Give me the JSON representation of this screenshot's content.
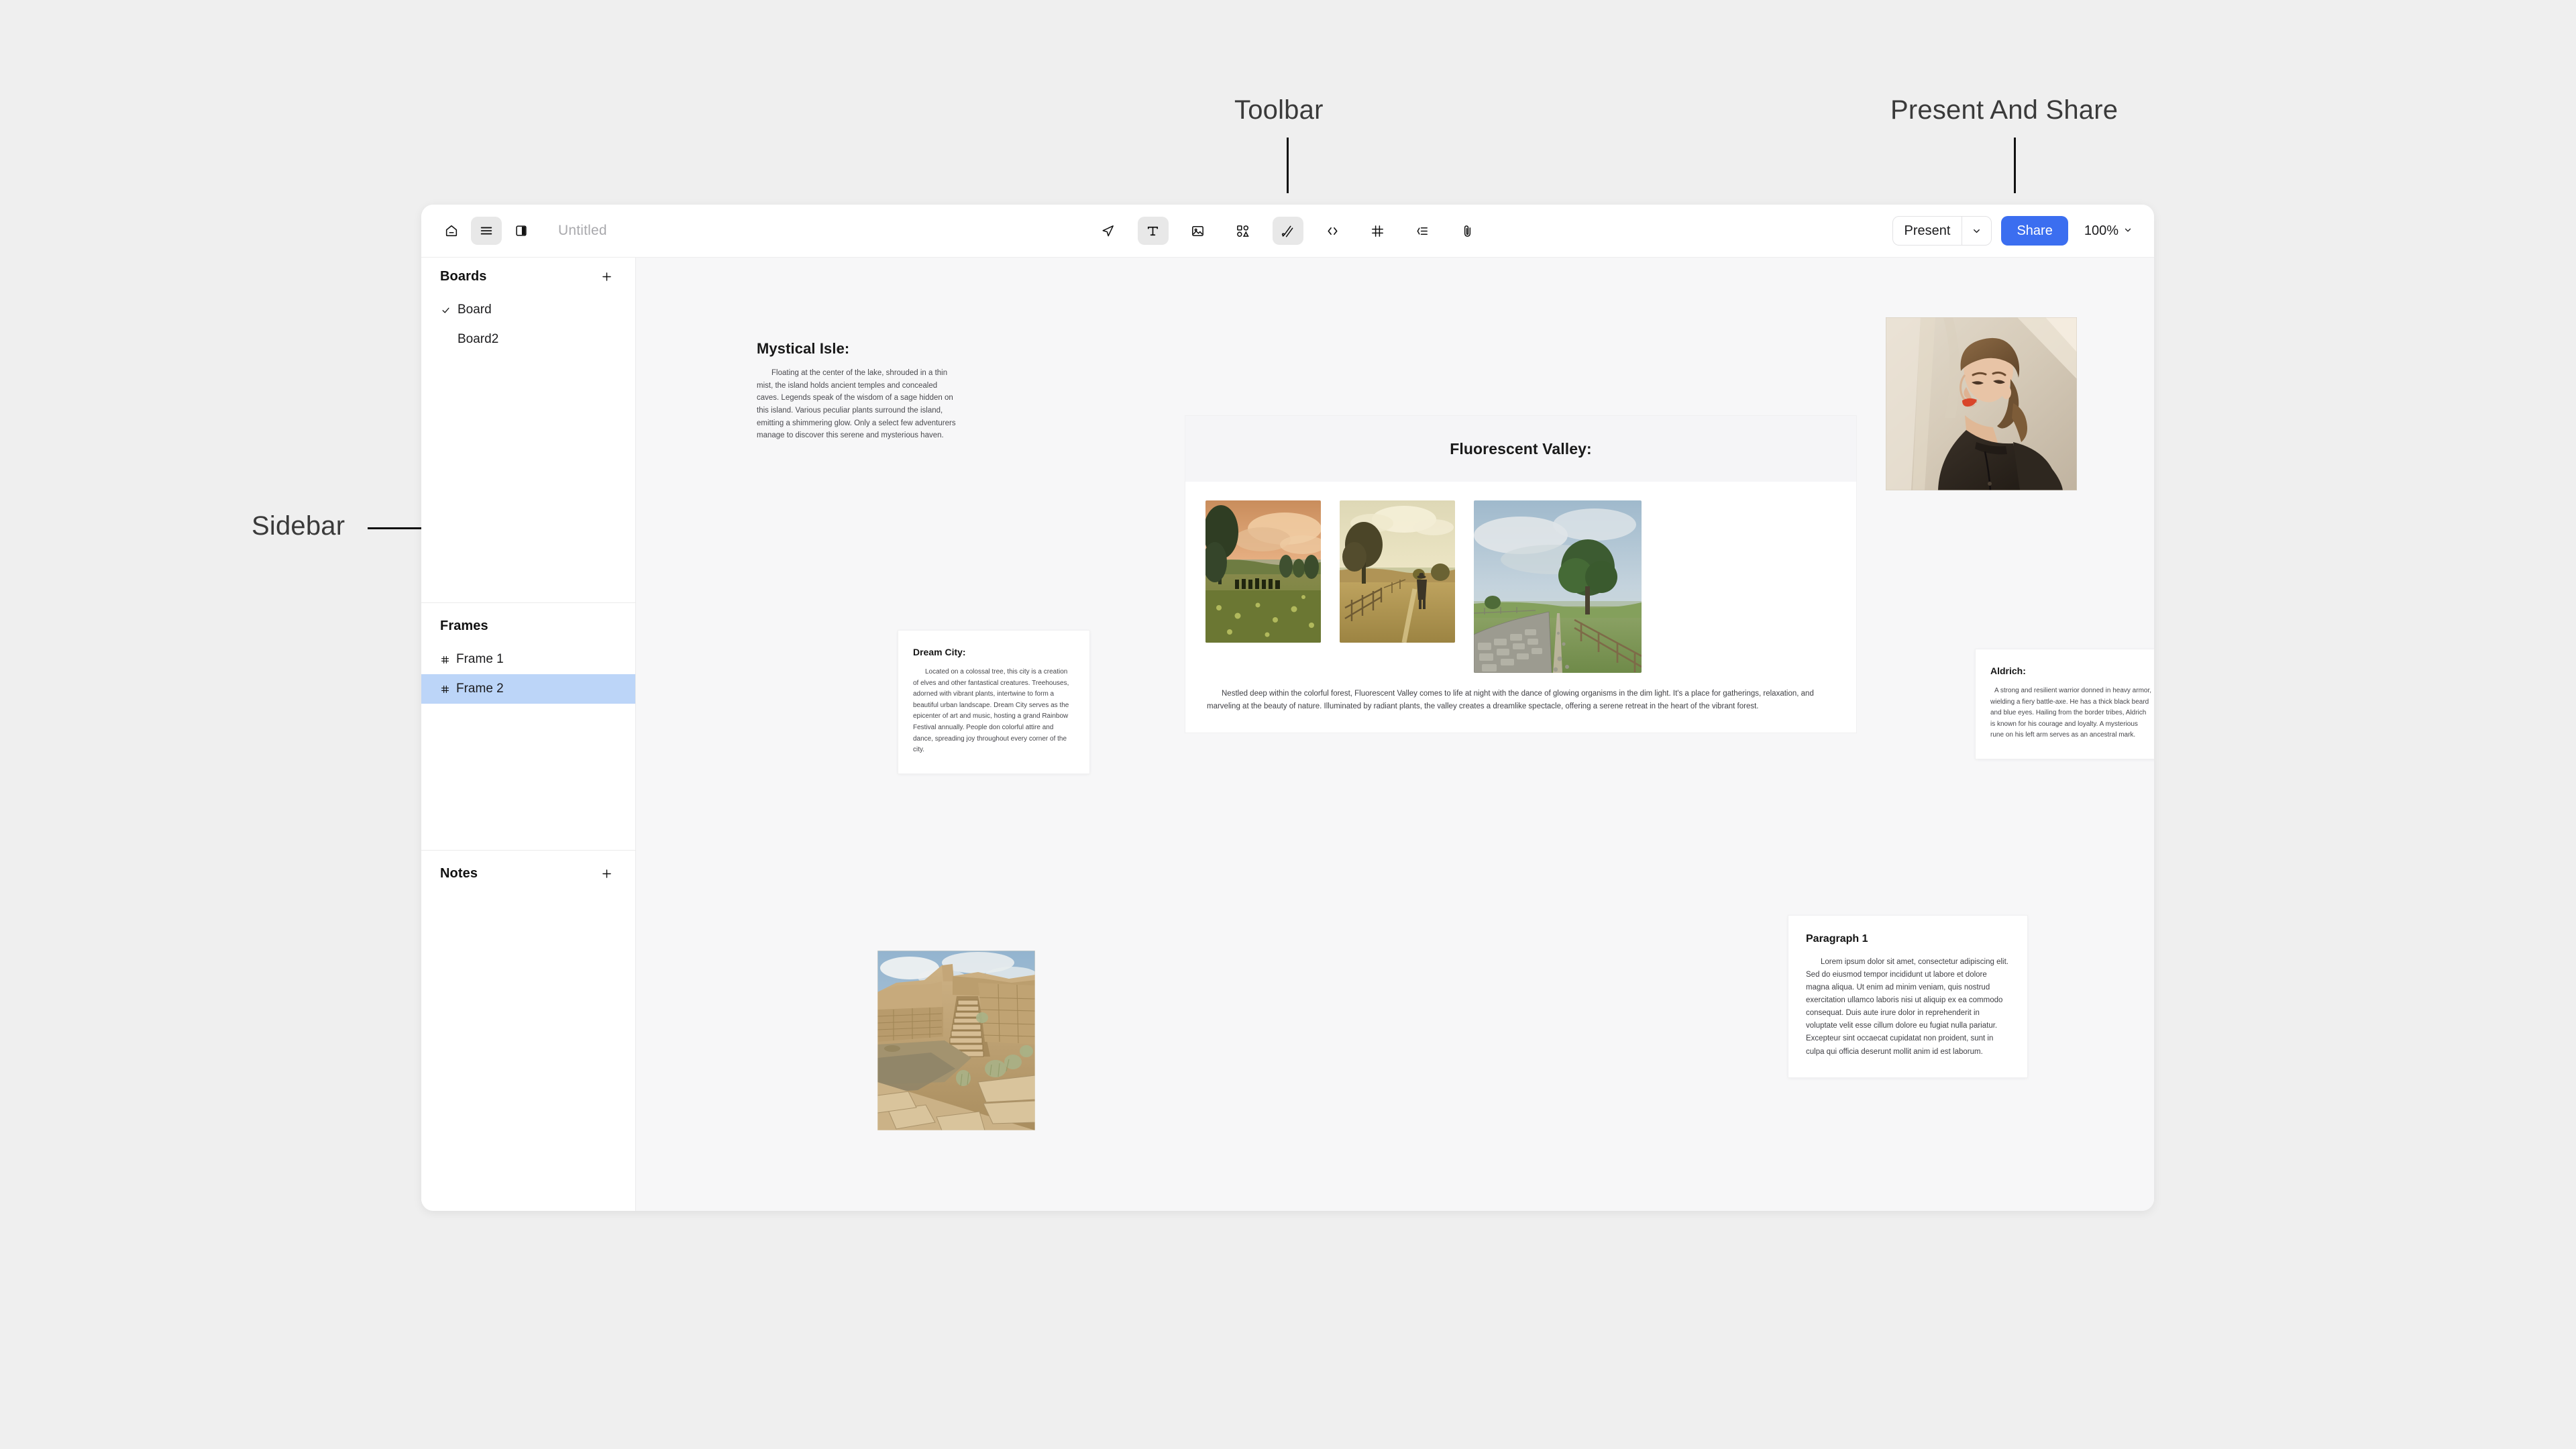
{
  "annotations": [
    {
      "id": "toolbar",
      "label": "Toolbar"
    },
    {
      "id": "present",
      "label": "Present And Share"
    },
    {
      "id": "sidebar",
      "label": "Sidebar"
    }
  ],
  "colors": {
    "accent": "#3b6ef0",
    "selection": "#bcd5f8",
    "canvas_bg": "#f7f7f8",
    "page_bg": "#efefef",
    "toolbar_active_bg": "#e8e8e8"
  },
  "topbar": {
    "left_icons": [
      {
        "name": "home-icon",
        "label": "Home"
      },
      {
        "name": "menu-icon",
        "label": "Menu",
        "active": true
      },
      {
        "name": "panel-toggle-icon",
        "label": "Toggle panel"
      }
    ],
    "document_title_placeholder": "Untitled",
    "document_title_value": "",
    "tools": [
      {
        "name": "cursor-icon",
        "label": "Select",
        "active": false
      },
      {
        "name": "text-icon",
        "label": "Text",
        "active": true
      },
      {
        "name": "image-icon",
        "label": "Image",
        "active": false
      },
      {
        "name": "shapes-icon",
        "label": "Shapes",
        "active": false
      },
      {
        "name": "pen-icon",
        "label": "Draw",
        "active": true
      },
      {
        "name": "code-icon",
        "label": "Embed",
        "active": false
      },
      {
        "name": "frame-icon",
        "label": "Frame",
        "active": false
      },
      {
        "name": "list-icon",
        "label": "List",
        "active": false
      },
      {
        "name": "attachment-icon",
        "label": "Attach",
        "active": false
      }
    ],
    "present_label": "Present",
    "share_label": "Share",
    "zoom_level": "100%"
  },
  "sidebar": {
    "boards": {
      "title": "Boards",
      "add_label": "+",
      "items": [
        {
          "label": "Board",
          "checked": true
        },
        {
          "label": "Board2",
          "checked": false
        }
      ]
    },
    "frames": {
      "title": "Frames",
      "items": [
        {
          "label": "Frame 1",
          "selected": false
        },
        {
          "label": "Frame 2",
          "selected": true
        }
      ]
    },
    "notes": {
      "title": "Notes",
      "add_label": "+",
      "items": []
    }
  },
  "canvas": {
    "mystical_isle": {
      "title": "Mystical Isle:",
      "body": "Floating at the center of the lake, shrouded in a thin mist, the island holds ancient temples and concealed caves. Legends speak of the wisdom of a sage hidden on this island. Various peculiar plants surround the island, emitting a shimmering glow. Only a select few adventurers manage to discover this serene and mysterious haven."
    },
    "fluorescent_valley": {
      "title": "Fluorescent Valley:",
      "images": [
        {
          "name": "landscape-cavalry-sunset",
          "alt": "Riders in a golden sunset meadow"
        },
        {
          "name": "landscape-walker-field",
          "alt": "Figure walking along a fence line in a field"
        },
        {
          "name": "landscape-stone-wall-tree",
          "alt": "Lone tree beside a stone wall path"
        }
      ],
      "body": "Nestled deep within the colorful forest, Fluorescent Valley comes to life at night with the dance of glowing organisms in the dim light. It's a place for gatherings, relaxation, and marveling at the beauty of nature. Illuminated by radiant plants, the valley creates a dreamlike spectacle, offering a serene retreat in the heart of the vibrant forest."
    },
    "dream_city": {
      "title": "Dream City:",
      "body": "Located on a colossal tree, this city is a creation of elves and other fantastical creatures. Treehouses, adorned with vibrant plants, intertwine to form a beautiful urban landscape. Dream City serves as the epicenter of art and music, hosting a grand Rainbow Festival annually. People don colorful attire and dance, spreading joy throughout every corner of the city."
    },
    "aldrich": {
      "title": "Aldrich:",
      "body": "A strong and resilient warrior donned in heavy armor, wielding a fiery battle-axe. He has a thick black beard and blue eyes. Hailing from the border tribes, Aldrich is known for his courage and loyalty. A mysterious rune on his left arm serves as an ancestral mark."
    },
    "paragraph_1": {
      "title": "Paragraph 1",
      "body": "Lorem ipsum dolor sit amet, consectetur adipiscing elit. Sed do eiusmod tempor incididunt ut labore et dolore magna aliqua. Ut enim ad minim veniam, quis nostrud exercitation ullamco laboris nisi ut aliquip ex ea commodo consequat. Duis aute irure dolor in reprehenderit in voluptate velit esse cillum dolore eu fugiat nulla pariatur. Excepteur sint occaecat cupidatat non proident, sunt in culpa qui officia deserunt mollit anim id est laborum."
    },
    "portrait_photo": {
      "name": "portrait-woman-photo",
      "alt": "Portrait of a woman with red lipstick against a sunlit wall"
    },
    "ruins_photo": {
      "name": "ruins-staircase-photo",
      "alt": "Ancient sandstone ruins with a stone staircase"
    }
  }
}
